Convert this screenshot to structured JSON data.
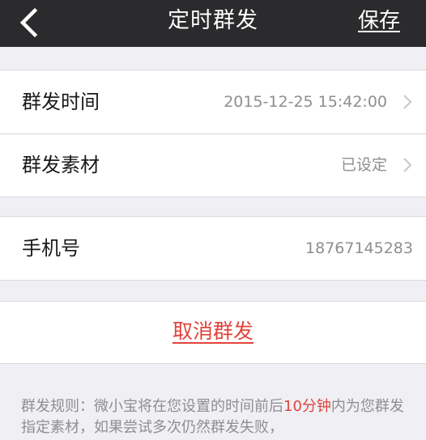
{
  "navbar": {
    "title": "定时群发",
    "save_label": "保存",
    "back_icon": "chevron-left-icon"
  },
  "schedule_group": {
    "rows": [
      {
        "label": "群发时间",
        "value": "2015-12-25 15:42:00"
      },
      {
        "label": "群发素材",
        "value": "已设定"
      }
    ]
  },
  "phone_group": {
    "label": "手机号",
    "value": "18767145283"
  },
  "cancel": {
    "label": "取消群发"
  },
  "rules": {
    "prefix": "群发规则：微小宝将在您设置的时间前后",
    "highlight": "10分钟",
    "suffix": "内为您群发指定素材，如果尝试多次仍然群发失败，"
  },
  "colors": {
    "navbar_bg": "#2b2b2d",
    "accent_red": "#e0443c",
    "page_bg": "#efeff4"
  }
}
